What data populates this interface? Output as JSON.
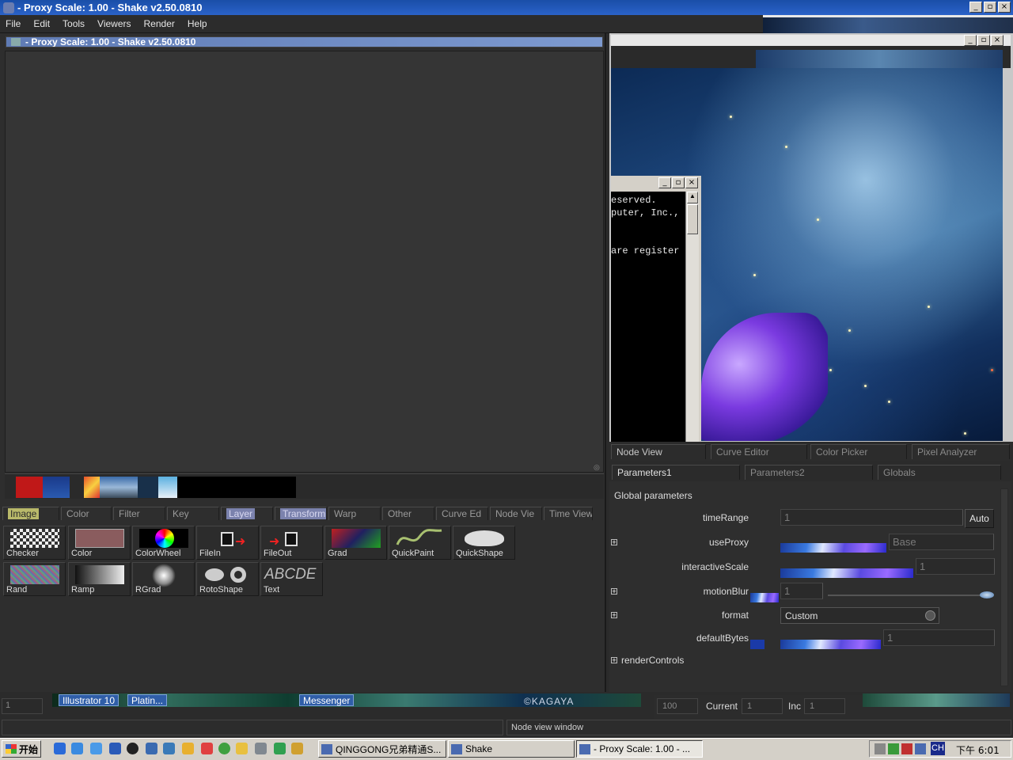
{
  "window": {
    "title": "- Proxy Scale: 1.00 - Shake v2.50.0810",
    "inner_title": "- Proxy Scale: 1.00 - Shake v2.50.0810",
    "controls": [
      "_",
      "▫",
      "×"
    ]
  },
  "menu": [
    "File",
    "Edit",
    "Tools",
    "Viewers",
    "Render",
    "Help"
  ],
  "tool_tabs": [
    {
      "label": "Image",
      "state": "selected-yellow"
    },
    {
      "label": "Color",
      "state": "normal"
    },
    {
      "label": "Filter",
      "state": "normal"
    },
    {
      "label": "Key",
      "state": "normal"
    },
    {
      "label": "Layer",
      "state": "highlight"
    },
    {
      "label": "Transform",
      "state": "highlight"
    },
    {
      "label": "Warp",
      "state": "normal"
    },
    {
      "label": "Other",
      "state": "normal"
    },
    {
      "label": "Curve Ed",
      "state": "normal"
    },
    {
      "label": "Node Vie",
      "state": "normal"
    },
    {
      "label": "Time View",
      "state": "normal"
    }
  ],
  "tools_row1": [
    "Checker",
    "Color",
    "ColorWheel",
    "FileIn",
    "FileOut",
    "Grad",
    "QuickPaint",
    "QuickShape"
  ],
  "tools_row2": [
    "Rand",
    "Ramp",
    "RGrad",
    "RotoShape",
    "Text"
  ],
  "text_tool_icon_text": "ABCDE",
  "taskstrip": {
    "buttons": [
      "Illustrator 10",
      "Platin...",
      "Messenger"
    ],
    "watermark": "©KAGAYA"
  },
  "frame_field": "1",
  "console": {
    "lines": [
      "eserved.",
      "puter, Inc.,",
      "",
      "are register"
    ]
  },
  "view_tabs": [
    "Node View",
    "Curve Editor",
    "Color Picker",
    "Pixel Analyzer"
  ],
  "param_tabs": [
    "Parameters1",
    "Parameters2",
    "Globals"
  ],
  "params": {
    "section": "Global parameters",
    "timeRange": {
      "label": "timeRange",
      "value": "1",
      "button": "Auto"
    },
    "useProxy": {
      "label": "useProxy",
      "value": "Base"
    },
    "interactiveScale": {
      "label": "interactiveScale",
      "value": "1"
    },
    "motionBlur": {
      "label": "motionBlur",
      "value": "1"
    },
    "format": {
      "label": "format",
      "value": "Custom"
    },
    "defaultBytes": {
      "label": "defaultBytes",
      "value": "1"
    },
    "renderControls": {
      "label": "renderControls"
    }
  },
  "infobar": {
    "end_frame": "100",
    "current_label": "Current",
    "current_value": "1",
    "inc_label": "Inc",
    "inc_value": "1"
  },
  "status_right": "Node view window",
  "taskbar": {
    "start": "开始",
    "buttons": [
      "QINGGONG兄弟精通S...",
      "Shake",
      "- Proxy Scale: 1.00 - ..."
    ],
    "ime": "CH",
    "clock": "下午 6:01"
  }
}
